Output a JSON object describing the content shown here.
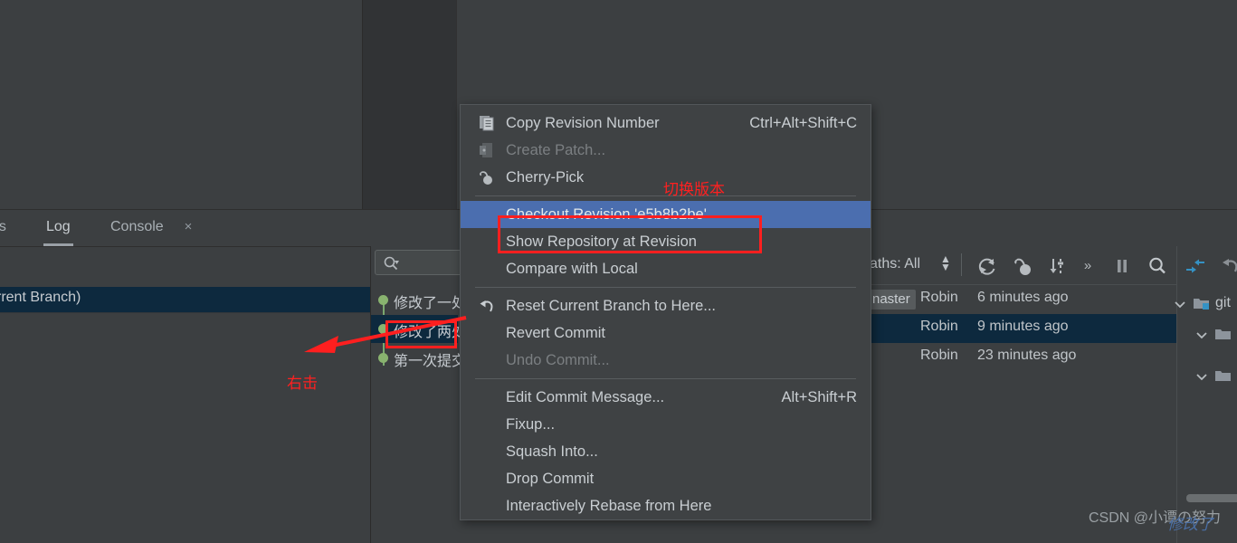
{
  "app": {
    "theme_bg": "#3c3f41",
    "accent_selected": "#4b6eaf",
    "row_selected_bg": "#0d293e",
    "annotation_color": "#ff1f1f"
  },
  "tool_window_tabs": {
    "tabs": [
      {
        "label": "es",
        "active": false,
        "clipped": true
      },
      {
        "label": "Log",
        "active": true,
        "clipped": false
      },
      {
        "label": "Console",
        "active": false,
        "clipped": false
      }
    ],
    "close_icon": "×"
  },
  "branch_panel": {
    "selected_row_label": "rrent Branch)"
  },
  "commit_column": {
    "search_placeholder": "",
    "commits": [
      {
        "message": "修改了一处",
        "selected": false
      },
      {
        "message": "修改了两处",
        "selected": true
      },
      {
        "message": "第一次提交",
        "selected": false
      }
    ]
  },
  "log_toolbar": {
    "paths_label": "aths: All",
    "buttons": [
      {
        "name": "refresh-button",
        "icon": "refresh-icon"
      },
      {
        "name": "cherry-pick-button",
        "icon": "cherry-icon"
      },
      {
        "name": "sort-button",
        "icon": "sort-icon"
      },
      {
        "name": "more-button",
        "icon": "chevron-double-right-icon",
        "label": "»"
      },
      {
        "name": "pause-button",
        "icon": "pause-icon"
      },
      {
        "name": "search-button",
        "icon": "search-icon"
      },
      {
        "name": "collapse-all-button",
        "icon": "collapse-arrows-icon"
      },
      {
        "name": "undo-button",
        "icon": "undo-arrow-icon"
      }
    ]
  },
  "log_rows": [
    {
      "branch_chip": "naster",
      "author": "Robin",
      "when": "6 minutes ago",
      "selected": false
    },
    {
      "branch_chip": "",
      "author": "Robin",
      "when": "9 minutes ago",
      "selected": true
    },
    {
      "branch_chip": "",
      "author": "Robin",
      "when": "23 minutes ago",
      "selected": false
    }
  ],
  "file_tree": [
    {
      "label": "git",
      "expanded": true,
      "depth": 0,
      "has_badge": true
    },
    {
      "label": "",
      "expanded": true,
      "depth": 1,
      "has_badge": false
    },
    {
      "label": "",
      "expanded": true,
      "depth": 1,
      "has_badge": false
    }
  ],
  "context_menu": {
    "items": [
      {
        "label": "Copy Revision Number",
        "accel": "Ctrl+Alt+Shift+C",
        "icon": "copy-icon",
        "disabled": false,
        "selected": false
      },
      {
        "label": "Create Patch...",
        "accel": "",
        "icon": "patch-icon",
        "disabled": true,
        "selected": false
      },
      {
        "label": "Cherry-Pick",
        "accel": "",
        "icon": "cherry-icon",
        "disabled": false,
        "selected": false
      },
      {
        "separator": true
      },
      {
        "label": "Checkout Revision 'e5b8b2be'",
        "accel": "",
        "icon": "",
        "disabled": false,
        "selected": true
      },
      {
        "label": "Show Repository at Revision",
        "accel": "",
        "icon": "",
        "disabled": false,
        "selected": false
      },
      {
        "label": "Compare with Local",
        "accel": "",
        "icon": "",
        "disabled": false,
        "selected": false
      },
      {
        "separator": true
      },
      {
        "label": "Reset Current Branch to Here...",
        "accel": "",
        "icon": "reset-icon",
        "disabled": false,
        "selected": false
      },
      {
        "label": "Revert Commit",
        "accel": "",
        "icon": "",
        "disabled": false,
        "selected": false
      },
      {
        "label": "Undo Commit...",
        "accel": "",
        "icon": "",
        "disabled": true,
        "selected": false
      },
      {
        "separator": true
      },
      {
        "label": "Edit Commit Message...",
        "accel": "Alt+Shift+R",
        "icon": "",
        "disabled": false,
        "selected": false
      },
      {
        "label": "Fixup...",
        "accel": "",
        "icon": "",
        "disabled": false,
        "selected": false
      },
      {
        "label": "Squash Into...",
        "accel": "",
        "icon": "",
        "disabled": false,
        "selected": false
      },
      {
        "label": "Drop Commit",
        "accel": "",
        "icon": "",
        "disabled": false,
        "selected": false
      },
      {
        "label": "Interactively Rebase from Here",
        "accel": "",
        "icon": "",
        "disabled": false,
        "selected": false
      }
    ]
  },
  "annotations": {
    "switch_version": "切换版本",
    "right_click": "右击"
  },
  "watermark": {
    "text": "CSDN @小谭の努力",
    "blue_text": "修改了"
  }
}
